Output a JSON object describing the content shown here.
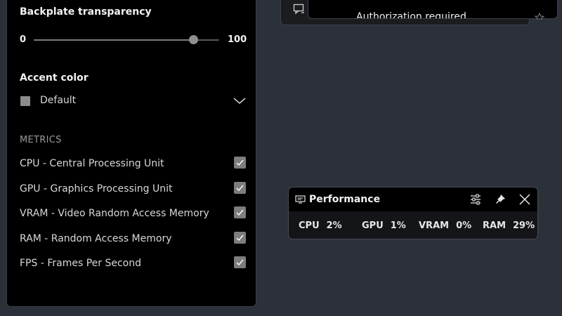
{
  "settings": {
    "backplate_transparency": {
      "label": "Backplate transparency",
      "min_label": "0",
      "max_label": "100",
      "value": 86
    },
    "accent_color": {
      "label": "Accent color",
      "selected": "Default",
      "swatch_color": "#8c8c8c"
    },
    "metrics": {
      "header": "METRICS",
      "items": [
        {
          "label": "CPU - Central Processing Unit",
          "checked": true
        },
        {
          "label": "GPU - Graphics Processing Unit",
          "checked": true
        },
        {
          "label": "VRAM - Video Random Access Memory",
          "checked": true
        },
        {
          "label": "RAM - Random Access Memory",
          "checked": true
        },
        {
          "label": "FPS - Frames Per Second",
          "checked": true
        }
      ]
    }
  },
  "notification": {
    "text": "Authorization required",
    "icon": "chat-screen-icon",
    "trailing_icon": "star-icon"
  },
  "performance": {
    "title": "Performance",
    "title_icon": "monitor-icon",
    "buttons": [
      "options-sliders-icon",
      "pin-icon",
      "close-icon"
    ],
    "stats": [
      {
        "name": "CPU",
        "value": "2%"
      },
      {
        "name": "GPU",
        "value": "1%"
      },
      {
        "name": "VRAM",
        "value": "0%"
      },
      {
        "name": "RAM",
        "value": "29%"
      }
    ]
  },
  "colors": {
    "desktop_bg": "#2c3039",
    "panel_bg": "#000000",
    "checkbox": "#7d7d7d",
    "slider_thumb": "#8f8f8f"
  }
}
